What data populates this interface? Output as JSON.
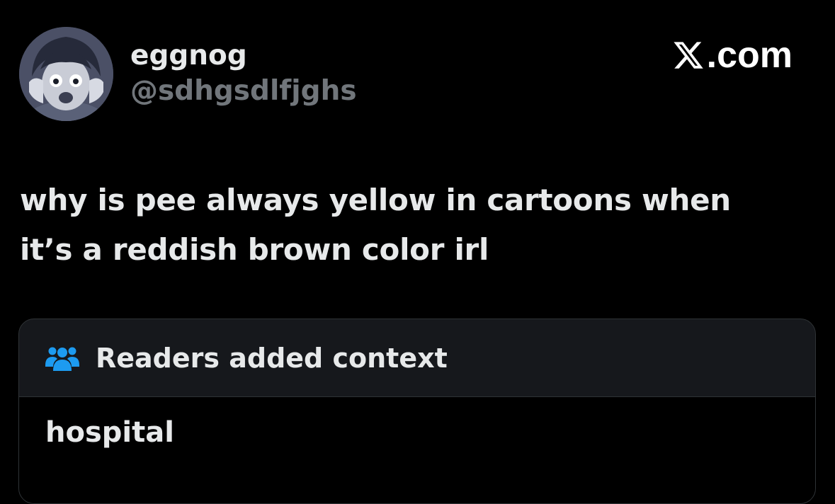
{
  "author": {
    "display_name": "eggnog",
    "handle": "@sdhgsdlfjghs",
    "avatar_icon": "anime-avatar-icon"
  },
  "brand": {
    "suffix": ".com",
    "logo_icon": "x-logo-icon"
  },
  "post": {
    "lines": [
      "why is pee always yellow in cartoons when",
      "it’s a reddish brown color irl"
    ]
  },
  "community_note": {
    "title": "Readers added context",
    "icon": "readers-icon",
    "body": "hospital",
    "accent_color": "#1d9bf0"
  },
  "colors": {
    "background": "#000000",
    "primary_text": "#e7e9ea",
    "secondary_text": "#71767b",
    "card_background": "#16181c",
    "border": "#2f3336"
  }
}
